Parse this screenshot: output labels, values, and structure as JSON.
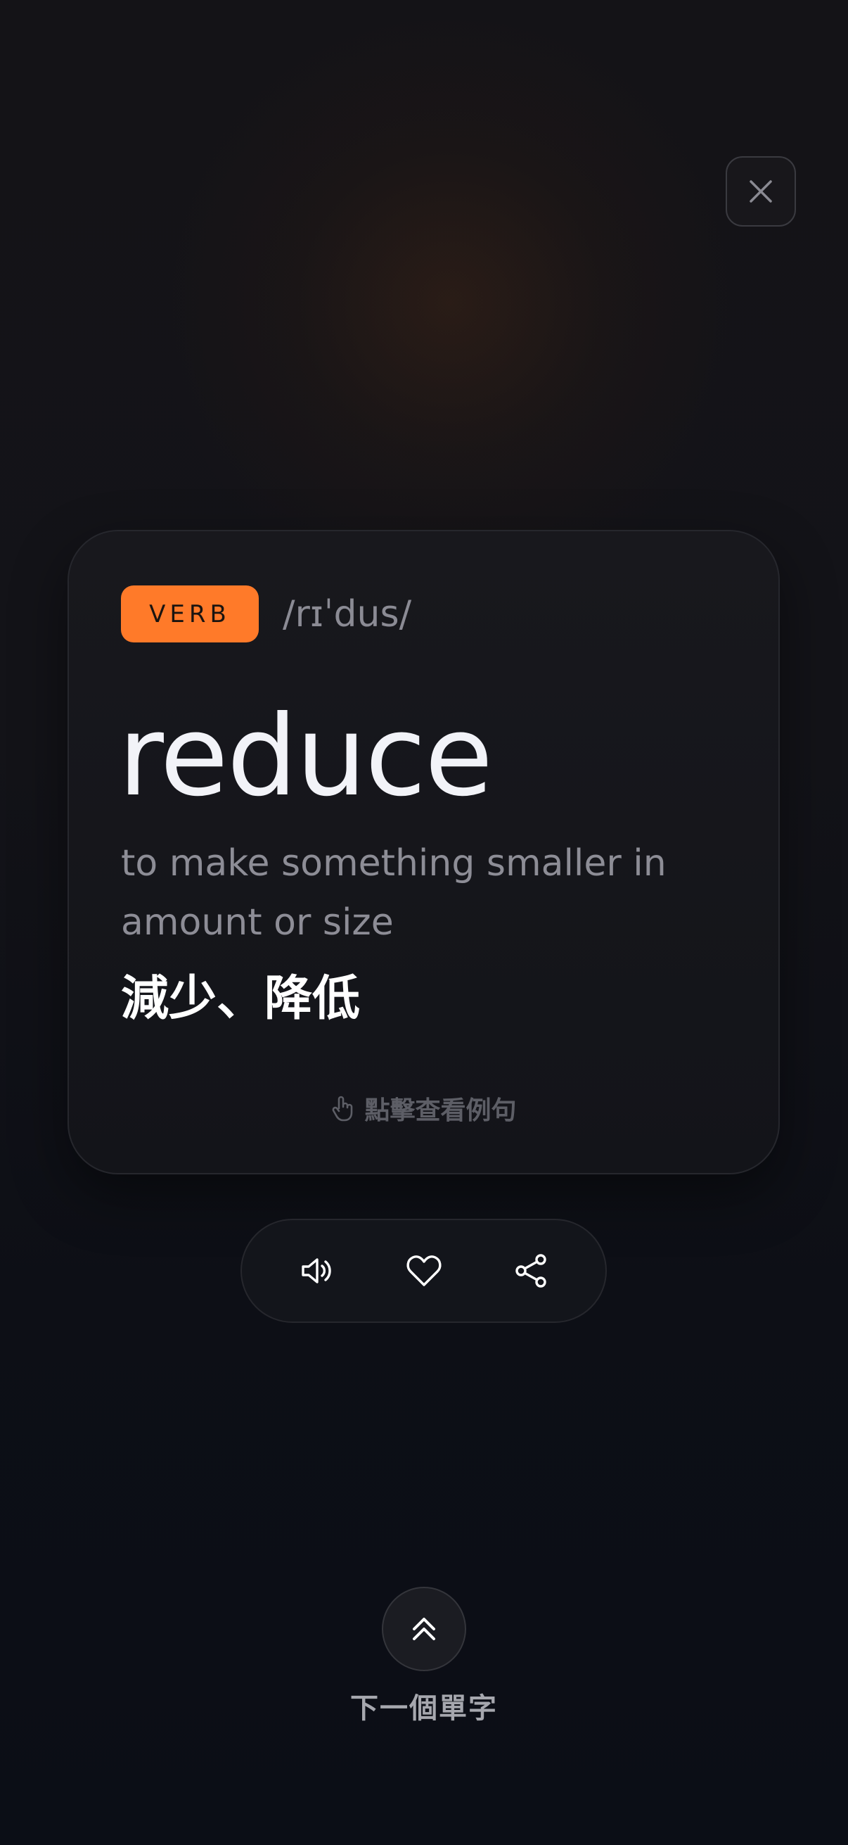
{
  "header": {
    "close_icon": "close-icon"
  },
  "card": {
    "part_of_speech": "VERB",
    "phonetic": "/rɪˈdus/",
    "word": "reduce",
    "definition": "to make something smaller in amount or size",
    "translation": "減少、降低",
    "hint": {
      "icon": "tap-finger-icon",
      "label": "點擊查看例句"
    }
  },
  "actions": {
    "items": [
      {
        "name": "speaker-icon"
      },
      {
        "name": "heart-icon"
      },
      {
        "name": "share-icon"
      }
    ]
  },
  "footer": {
    "next_icon": "double-chevron-up-icon",
    "next_label": "下一個單字"
  },
  "colors": {
    "accent": "#ff7a29",
    "background": "#0d0f16",
    "card": "#16171c"
  }
}
